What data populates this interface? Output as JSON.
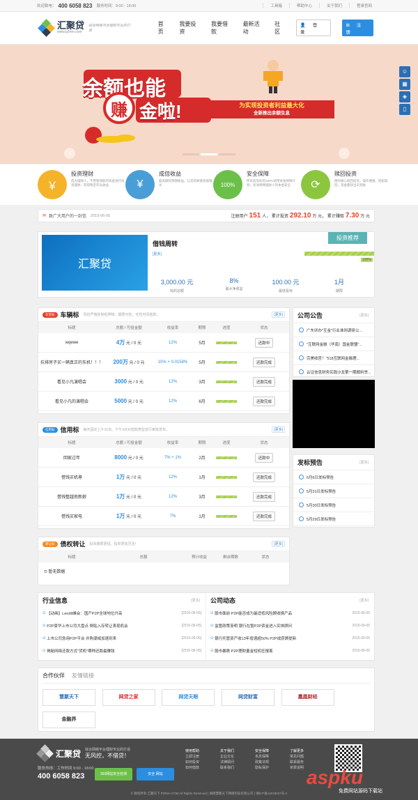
{
  "topbar": {
    "welcome": "欢迎致电：",
    "hotline": "400 6058 823",
    "hours": "服务时间：9:00 - 18:00",
    "links": [
      "工具箱",
      "帮助中心",
      "关于我们",
      "登录官网"
    ]
  },
  "header": {
    "logo_name": "汇聚贷",
    "logo_url": "www.p2ren.com",
    "slogan": "综合网络平台理财专业的打造",
    "nav": [
      "首页",
      "我要投资",
      "我要借款",
      "最新活动",
      "社区"
    ],
    "login": "登 录",
    "register": "注册"
  },
  "banner": {
    "line1": "余额也能",
    "line2_char": "赚",
    "line2": "金啦!",
    "tag_main": "为实现投资者利益最大化",
    "tag_sub": "全新推出余额生息"
  },
  "side_tools": [
    "客服",
    "计算器",
    "收藏",
    "手机"
  ],
  "features": [
    {
      "title": "投资理财",
      "desc": "成为理财人，不用管领取的资金进行投资理财，获得稳定年化收益",
      "color": "#f5b32a",
      "icon": "￥"
    },
    {
      "title": "成倍收益",
      "desc": "超高额的预期收益，让您的财富快速增长",
      "color": "#4a9ed8",
      "icon": "¥"
    },
    {
      "title": "安全保障",
      "desc": "所有投资标的100%适用本金保障计划，有效保障理财人的本金安全",
      "color": "#6cc04a",
      "icon": "100%"
    },
    {
      "title": "赎回投资",
      "desc": "随时随心赎回投资，操作便捷，轻松赎回，资金最快当天到账",
      "color": "#8cc63f",
      "icon": "⟳"
    }
  ],
  "notice": {
    "title": "致广大用户的一封信",
    "date": "2015-06-05",
    "reg_label": "注册用户",
    "reg_count": "151",
    "reg_unit": "人",
    "invest_label": "累计投资",
    "invest_amount": "292.10",
    "invest_unit": "万 元",
    "earn_label": "累计赚取",
    "earn_amount": "7.30",
    "earn_unit": "万 元"
  },
  "product": {
    "name": "借钱周转",
    "more": "[更多]",
    "badge": "投资推荐",
    "pct": "100%",
    "img_text": "汇聚贷",
    "stats": [
      {
        "value": "3,000.00 元",
        "label": "标的总额"
      },
      {
        "value": "8%",
        "label": "最大净收益"
      },
      {
        "value": "100.00 元",
        "label": "最低投标"
      },
      {
        "value": "1月",
        "label": "期限"
      }
    ]
  },
  "car": {
    "pill": "车贷标",
    "title": "车辆标",
    "desc": "风控严格控制抵押物，期限可控，任性时间放款。",
    "more": "[更多]",
    "headers": [
      "标题",
      "总额 / 可投金额",
      "收益率",
      "期限",
      "进度",
      "状态"
    ],
    "rows": [
      {
        "title": "wqewe",
        "amount": "4万",
        "avail": "元 / 0 元",
        "rate": "12%",
        "term": "5月",
        "status": "还款中"
      },
      {
        "title": "抗排房子买一辆真正的东机！！！",
        "amount": "200万",
        "avail": "元 / 0 元",
        "rate": "10% + 0.0158%",
        "term": "5月",
        "status": "还款完成"
      },
      {
        "title": "看见小凡演唱会",
        "amount": "3000",
        "avail": "元 / 0 元",
        "rate": "12%",
        "term": "3月",
        "status": "还款完成"
      },
      {
        "title": "看见小凡的演唱会",
        "amount": "5000",
        "avail": "元 / 0 元",
        "rate": "12%",
        "term": "6月",
        "status": "还款完成"
      }
    ]
  },
  "credit": {
    "pill": "信用标",
    "title": "信用标",
    "desc": "每天固定上午10点、下午3点对借款类型进行审核发布。",
    "more": "[更多]",
    "headers": [
      "标题",
      "总额 / 可投金额",
      "收益率",
      "期限",
      "进度",
      "状态"
    ],
    "rows": [
      {
        "title": "回家过年",
        "amount": "8000",
        "avail": "元 / 0 元",
        "rate": "7% + 1%",
        "term": "2月",
        "status": "还款中"
      },
      {
        "title": "借钱买机尊",
        "amount": "1万",
        "avail": "元 / 0 元",
        "rate": "12%",
        "term": "1月",
        "status": "还款完成"
      },
      {
        "title": "借钱整越南新娘",
        "amount": "1万",
        "avail": "元 / 0 元",
        "rate": "12%",
        "term": "3月",
        "status": "还款完成"
      },
      {
        "title": "借钱买家电",
        "amount": "1万",
        "avail": "元 / 0 元",
        "rate": "7%",
        "term": "1月",
        "status": "还款完成"
      }
    ]
  },
  "transfer": {
    "pill": "转让标",
    "title": "债权转让",
    "desc": "投资期限更短，投资更加灵活！",
    "more": "[更多]",
    "headers": [
      "标题",
      "总额",
      "预计收益",
      "剩余期数",
      "状态"
    ],
    "empty": "暂无数据"
  },
  "announce": {
    "title": "公司公告",
    "more": "[更多]",
    "items": [
      "广东卯办\"互金\"行业准则调研公...",
      "\"互联网金融（华南）国金联盟\"...",
      "完美收官！\"518互联网金融理...",
      "云证信息财务实践沙龙第一期顺利举..."
    ]
  },
  "release": {
    "title": "发标预告",
    "more": "[更多]",
    "items": [
      "6月6日发标预告",
      "5月31日发标预告",
      "5月30日发标预告",
      "5月29日发标预告"
    ]
  },
  "industry": {
    "title": "行业信息",
    "more": "[更多]",
    "items": [
      {
        "text": "【动画】LendIt峰会：国产P2P全球地位升高",
        "date": "[2015-06-05]"
      },
      {
        "text": "P2P豪华上市公司大盘点 倒贴入存转让表现机会",
        "date": "[2015-06-05]"
      },
      {
        "text": "上市公司急用P2P平台 并购潮或加速到来",
        "date": "[2015-06-05]"
      },
      {
        "text": "揭秘网络还款方式\"货机\"哪种还款最赚钱",
        "date": "[2015-06-05]"
      }
    ]
  },
  "company": {
    "title": "公司动态",
    "more": "[更多]",
    "items": [
      {
        "text": "股市面前 P2P能否成为最适低风险顾收换产品",
        "date": "2015-06-05"
      },
      {
        "text": "监管政策渐明 银行在暂P2P资金进入实体顾问",
        "date": "2015-06-05"
      },
      {
        "text": "银行托管资产收13年增速超50% P2P成获顾提新",
        "date": "2015-06-05"
      },
      {
        "text": "股市暴跌 P2P理财量金短机狂报客",
        "date": "2015-06-05"
      }
    ]
  },
  "partners": {
    "tab_active": "合作伙伴",
    "tab_other": "友情链接",
    "items": [
      "慧聚天下",
      "网贷之家",
      "网贷天眼",
      "网贷财富",
      "鳳凰财经",
      "金融界"
    ]
  },
  "footer": {
    "logo_name": "汇聚贷",
    "slogan": "综合网络平台理财专业的打造",
    "slogan2": "无风控，不借贷！",
    "hotline_label": "服务热线：",
    "hours": "工作时间 9:00 - 18:00",
    "hotline": "400 6058 823",
    "cols": [
      {
        "title": "使用帮助",
        "items": [
          "立即注册",
          "如何投资",
          "如何借款"
        ]
      },
      {
        "title": "关于我们",
        "items": [
          "企业文化",
          "法律顾问",
          "联系我们"
        ]
      },
      {
        "title": "安全保障",
        "items": [
          "本息保障",
          "政策法规",
          "隐私保护"
        ]
      },
      {
        "title": "了解更多",
        "items": [
          "常见问题",
          "联系服务",
          "资费说明"
        ]
      }
    ],
    "copyright": "© 版权所有 汇聚天下 P2Ren.COM All Rights Reserved | 湖南慧聚天下网络科技有限公司 | 湘ICP备14018047号-2"
  },
  "watermark": {
    "main": "aspku",
    "sub": "免费网站源码下载站"
  }
}
